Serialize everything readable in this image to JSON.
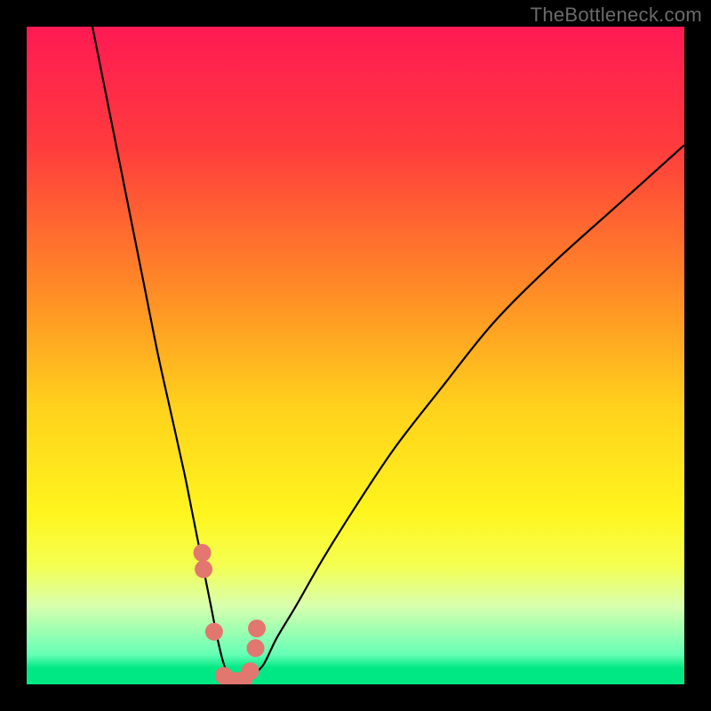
{
  "watermark": "TheBottleneck.com",
  "frame": {
    "outer_w": 800,
    "outer_h": 800,
    "inner_left": 30,
    "inner_top": 30,
    "inner_w": 740,
    "inner_h": 740
  },
  "chart_data": {
    "type": "line",
    "title": "",
    "xlabel": "",
    "ylabel": "",
    "xlim": [
      0,
      100
    ],
    "ylim": [
      0,
      100
    ],
    "gradient_stops": [
      {
        "offset": 0,
        "color": "#ff1a53"
      },
      {
        "offset": 0.18,
        "color": "#ff3b3d"
      },
      {
        "offset": 0.4,
        "color": "#ff8b26"
      },
      {
        "offset": 0.58,
        "color": "#ffd21c"
      },
      {
        "offset": 0.74,
        "color": "#fff51e"
      },
      {
        "offset": 0.82,
        "color": "#f4ff52"
      },
      {
        "offset": 0.88,
        "color": "#d9ffae"
      },
      {
        "offset": 0.955,
        "color": "#65ffb5"
      },
      {
        "offset": 0.975,
        "color": "#00e884"
      },
      {
        "offset": 1.0,
        "color": "#00e884"
      }
    ],
    "series": [
      {
        "name": "bottleneck-curve",
        "x": [
          10,
          12,
          14,
          16,
          18,
          20,
          22,
          24,
          25,
          26,
          27,
          28,
          29,
          30,
          31,
          32,
          33,
          34,
          36,
          38,
          41,
          45,
          50,
          56,
          63,
          71,
          80,
          90,
          100
        ],
        "y": [
          100,
          90,
          80,
          70,
          60,
          50,
          41,
          32,
          27,
          22,
          17,
          12,
          7,
          3,
          1,
          0,
          0,
          1,
          3,
          7,
          12,
          19,
          27,
          36,
          45,
          55,
          64,
          73,
          82
        ]
      }
    ],
    "markers": {
      "name": "highlight-points",
      "x": [
        26.7,
        26.9,
        28.5,
        30.0,
        31.0,
        32.0,
        33.0,
        34.0,
        34.8,
        35.0
      ],
      "y": [
        20.0,
        17.5,
        8.0,
        1.3,
        0.6,
        0.5,
        0.7,
        2.0,
        5.5,
        8.5
      ],
      "r": 10
    }
  }
}
